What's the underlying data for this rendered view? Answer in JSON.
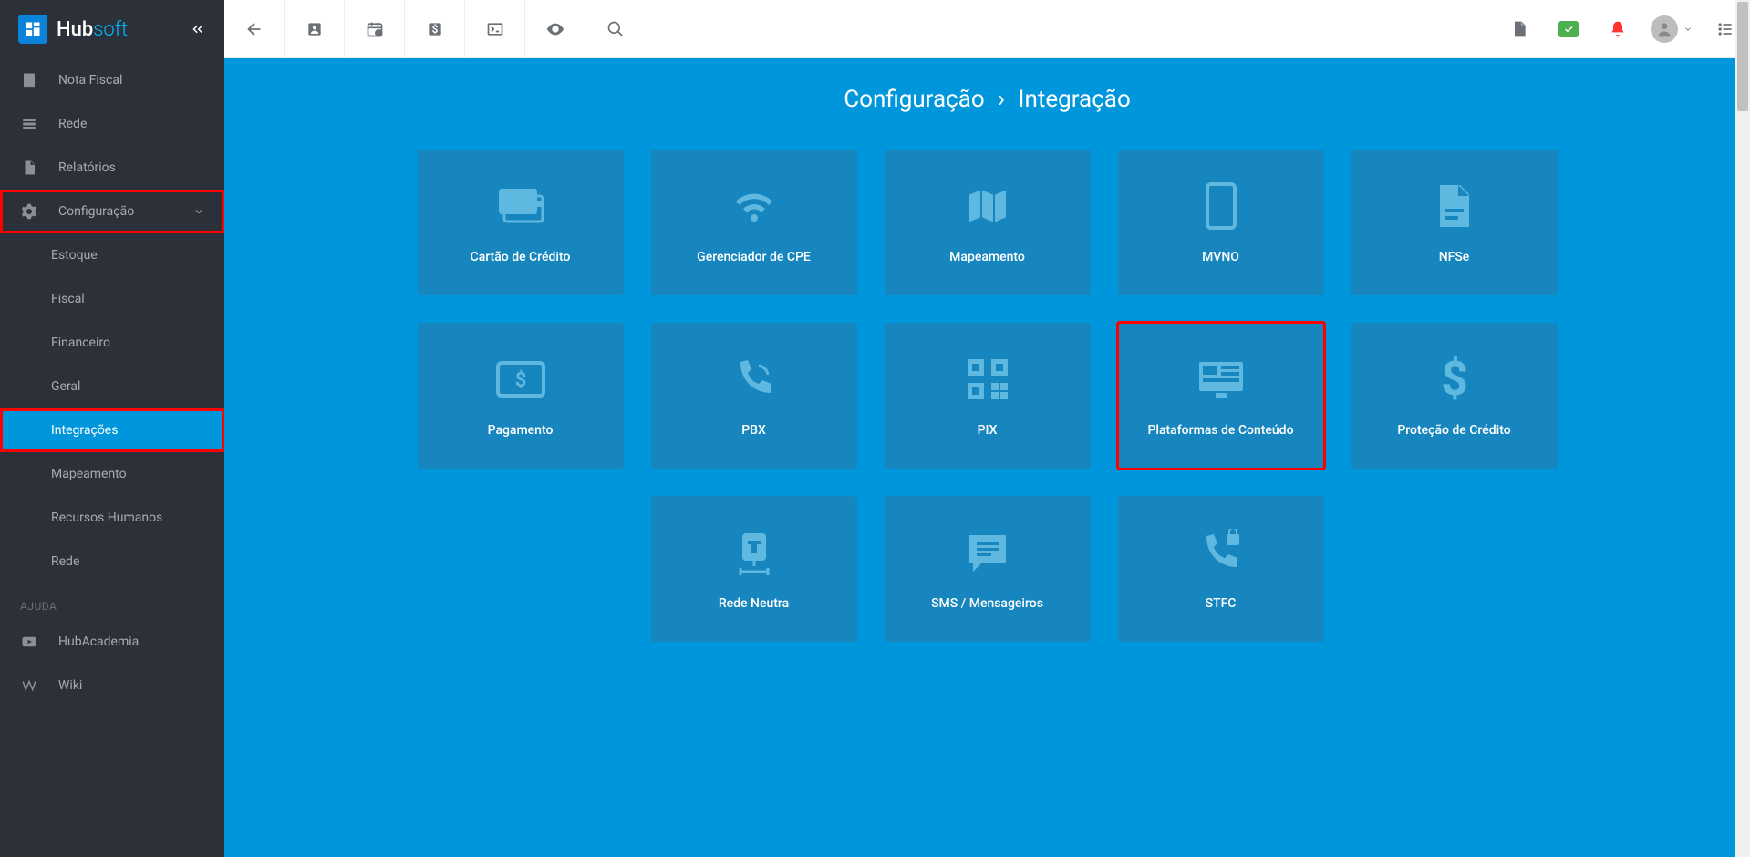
{
  "logo": {
    "brand": "Hub",
    "suffix": "soft"
  },
  "sidebar": {
    "items": [
      {
        "label": "Nota Fiscal",
        "icon": "receipt"
      },
      {
        "label": "Rede",
        "icon": "network"
      },
      {
        "label": "Relatórios",
        "icon": "file"
      },
      {
        "label": "Configuração",
        "icon": "gear",
        "expandable": true
      }
    ],
    "subs": [
      {
        "label": "Estoque"
      },
      {
        "label": "Fiscal"
      },
      {
        "label": "Financeiro"
      },
      {
        "label": "Geral"
      },
      {
        "label": "Integrações",
        "active": true
      },
      {
        "label": "Mapeamento"
      },
      {
        "label": "Recursos Humanos"
      },
      {
        "label": "Rede"
      }
    ],
    "help_header": "AJUDA",
    "help": [
      {
        "label": "HubAcademia",
        "icon": "youtube"
      },
      {
        "label": "Wiki",
        "icon": "wiki"
      }
    ]
  },
  "breadcrumb": {
    "a": "Configuração",
    "sep": "›",
    "b": "Integração"
  },
  "tiles": [
    {
      "label": "Cartão de Crédito",
      "icon": "credit-card"
    },
    {
      "label": "Gerenciador de CPE",
      "icon": "wifi"
    },
    {
      "label": "Mapeamento",
      "icon": "map"
    },
    {
      "label": "MVNO",
      "icon": "phone"
    },
    {
      "label": "NFSe",
      "icon": "doc"
    },
    {
      "label": "Pagamento",
      "icon": "payment"
    },
    {
      "label": "PBX",
      "icon": "call"
    },
    {
      "label": "PIX",
      "icon": "qr"
    },
    {
      "label": "Plataformas de Conteúdo",
      "icon": "desktop",
      "hl": true
    },
    {
      "label": "Proteção de Crédito",
      "icon": "dollar"
    },
    {
      "label": "Rede Neutra",
      "icon": "server"
    },
    {
      "label": "SMS / Mensageiros",
      "icon": "chat"
    },
    {
      "label": "STFC",
      "icon": "phone-lock"
    }
  ]
}
